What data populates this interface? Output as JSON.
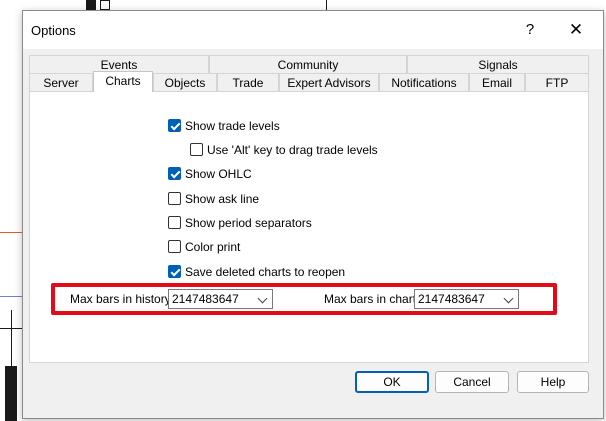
{
  "dialog": {
    "title": "Options",
    "help_glyph": "?",
    "close_glyph": "✕"
  },
  "tabs": {
    "row_top": [
      "Events",
      "Community",
      "Signals"
    ],
    "row_bottom": [
      "Server",
      "Charts",
      "Objects",
      "Trade",
      "Expert Advisors",
      "Notifications",
      "Email",
      "FTP"
    ],
    "active": "Charts"
  },
  "options": [
    {
      "label": "Show trade levels",
      "checked": true
    },
    {
      "label": "Use 'Alt' key to drag trade levels",
      "checked": false
    },
    {
      "label": "Show OHLC",
      "checked": true
    },
    {
      "label": "Show ask line",
      "checked": false
    },
    {
      "label": "Show period separators",
      "checked": false
    },
    {
      "label": "Color print",
      "checked": false
    },
    {
      "label": "Save deleted charts to reopen",
      "checked": true
    }
  ],
  "max_bars": {
    "history_label": "Max bars in history:",
    "history_value": "2147483647",
    "chart_label": "Max bars in chart:",
    "chart_value": "2147483647"
  },
  "buttons": {
    "ok": "OK",
    "cancel": "Cancel",
    "help": "Help"
  },
  "colors": {
    "accent": "#005fb8",
    "highlight": "#e30b17"
  }
}
